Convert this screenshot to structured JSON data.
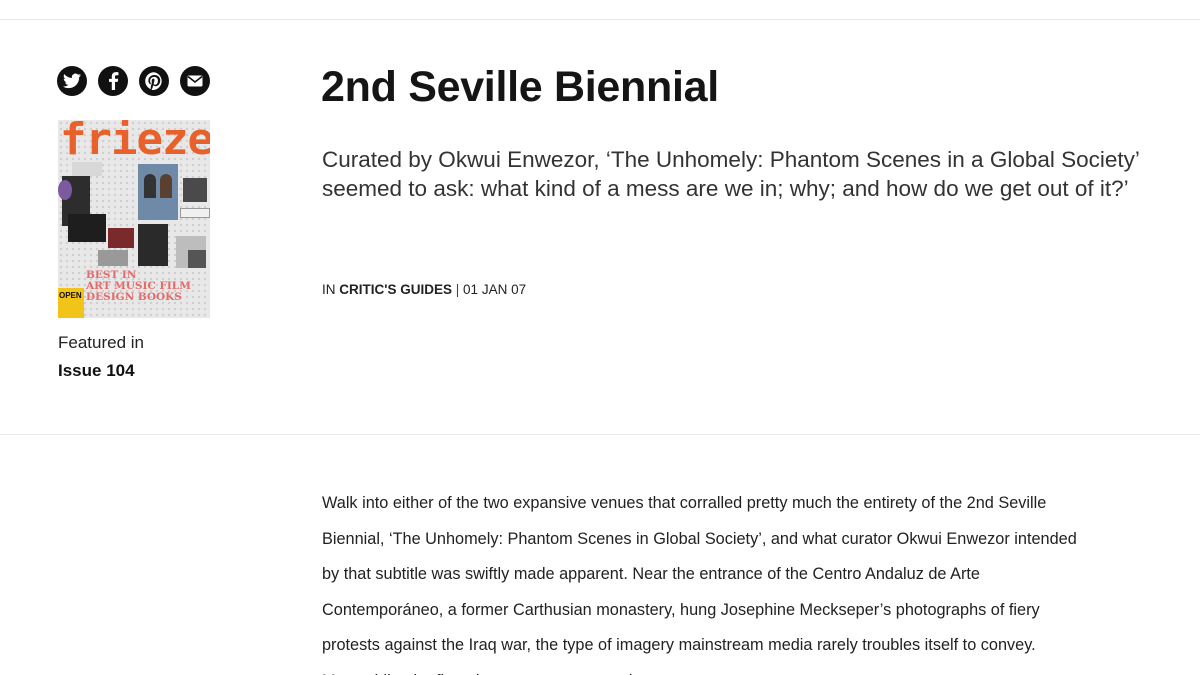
{
  "share": {
    "icons": [
      "twitter-icon",
      "facebook-icon",
      "pinterest-icon",
      "email-icon"
    ]
  },
  "sidebar": {
    "cover": {
      "logo": "frieze",
      "tagline_1": "BEST IN",
      "tagline_2": "ART MUSIC FILM",
      "tagline_3": "DESIGN BOOKS",
      "open_label": "OPEN"
    },
    "featured_label": "Featured in",
    "issue_label": "Issue 104"
  },
  "article": {
    "title": "2nd Seville Biennial",
    "standfirst": "Curated by Okwui Enwezor, ‘The Unhomely: Phantom Scenes in a Global Society’ seemed to ask: what kind of a mess are we in; why; and how do we get out of it?’",
    "meta": {
      "prefix": "IN",
      "category": "CRITIC'S GUIDES",
      "separator": "|",
      "date": "01 JAN 07"
    },
    "body": "Walk into either of the two expansive venues that corralled pretty much the entirety of the 2nd Seville Biennial, ‘The Unhomely: Phantom Scenes in Global Society’, and what curator Okwui Enwezor intended by that subtitle was swiftly made apparent. Near the entrance of the Centro Andaluz de Arte Contemporáneo, a former Carthusian monastery, hung Josephine Meckseper’s photographs of fiery protests against the Iraq war, the type of imagery mainstream media rarely troubles itself to convey. Meanwhile, the first piece one encountered"
  },
  "colors": {
    "text": "#1a1a1a",
    "rule": "#e9e9e9",
    "frieze_orange": "#e8612a"
  }
}
